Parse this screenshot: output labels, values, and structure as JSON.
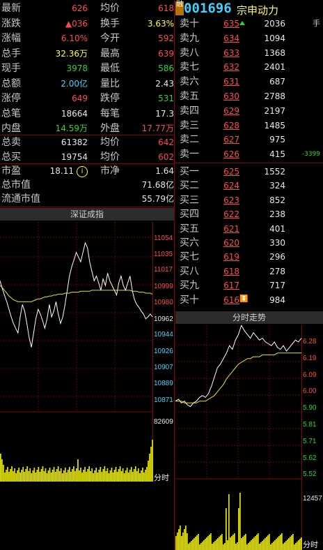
{
  "quote": {
    "rows": [
      {
        "l1": "最新",
        "v1": "626",
        "c1": "red",
        "l2": "均价",
        "v2": "618",
        "c2": "red"
      },
      {
        "l1": "涨跌",
        "v1": "▲036",
        "c1": "red",
        "l2": "换手",
        "v2": "3.63%",
        "c2": "yel"
      },
      {
        "l1": "涨幅",
        "v1": "6.10%",
        "c1": "red",
        "l2": "今开",
        "v2": "592",
        "c2": "red"
      },
      {
        "l1": "总手",
        "v1": "32.36万",
        "c1": "yel",
        "l2": "最高",
        "v2": "639",
        "c2": "red"
      },
      {
        "l1": "现手",
        "v1": "3978",
        "c1": "grn",
        "l2": "最低",
        "v2": "586",
        "c2": "grn"
      },
      {
        "l1": "总额",
        "v1": "2.00亿",
        "c1": "cyan",
        "l2": "量比",
        "v2": "2.43",
        "c2": "wht"
      },
      {
        "l1": "涨停",
        "v1": "649",
        "c1": "red",
        "l2": "跌停",
        "v2": "531",
        "c2": "grn"
      },
      {
        "l1": "总笔",
        "v1": "18664",
        "c1": "wht",
        "l2": "每笔",
        "v2": "17.3",
        "c2": "wht"
      },
      {
        "l1": "内盘",
        "v1": "14.59万",
        "c1": "grn",
        "l2": "外盘",
        "v2": "17.77万",
        "c2": "red"
      }
    ],
    "rows2": [
      {
        "l1": "总卖",
        "v1": "61382",
        "c1": "wht",
        "l2": "均价",
        "v2": "642",
        "c2": "red"
      },
      {
        "l1": "总买",
        "v1": "19754",
        "c1": "wht",
        "l2": "均价",
        "v2": "602",
        "c2": "red"
      }
    ],
    "pe_label": "市盈",
    "pe_value": "18.11",
    "pe_icon": "i",
    "pb_label": "市净",
    "pb_value": "1.64",
    "mcap_label": "总市值",
    "mcap_value": "71.68亿",
    "float_label": "流通市值",
    "float_value": "55.79亿"
  },
  "stock": {
    "code": "001696",
    "name": "宗申动力",
    "badge": "融"
  },
  "orderbook": {
    "sells": [
      {
        "label": "卖十",
        "price": "635",
        "vol": "2036",
        "extra": "手"
      },
      {
        "label": "卖九",
        "price": "634",
        "vol": "1094",
        "extra": ""
      },
      {
        "label": "卖八",
        "price": "633",
        "vol": "1368",
        "extra": ""
      },
      {
        "label": "卖七",
        "price": "632",
        "vol": "2401",
        "extra": ""
      },
      {
        "label": "卖六",
        "price": "631",
        "vol": "687",
        "extra": ""
      },
      {
        "label": "卖五",
        "price": "630",
        "vol": "2788",
        "extra": ""
      },
      {
        "label": "卖四",
        "price": "629",
        "vol": "2197",
        "extra": ""
      },
      {
        "label": "卖三",
        "price": "628",
        "vol": "1485",
        "extra": ""
      },
      {
        "label": "卖二",
        "price": "627",
        "vol": "975",
        "extra": ""
      },
      {
        "label": "卖一",
        "price": "626",
        "vol": "415",
        "extra": "-3399"
      }
    ],
    "buys": [
      {
        "label": "买一",
        "price": "625",
        "vol": "1552"
      },
      {
        "label": "买二",
        "price": "624",
        "vol": "324"
      },
      {
        "label": "买三",
        "price": "623",
        "vol": "852"
      },
      {
        "label": "买四",
        "price": "622",
        "vol": "238"
      },
      {
        "label": "买五",
        "price": "621",
        "vol": "401"
      },
      {
        "label": "买六",
        "price": "620",
        "vol": "330"
      },
      {
        "label": "买七",
        "price": "619",
        "vol": "296"
      },
      {
        "label": "买八",
        "price": "618",
        "vol": "278"
      },
      {
        "label": "买九",
        "price": "617",
        "vol": "717"
      },
      {
        "label": "买十",
        "price": "616",
        "vol": "984"
      }
    ]
  },
  "index_panel": {
    "title": "深证成指",
    "y_labels": [
      "11054",
      "11035",
      "11017",
      "10999",
      "10980",
      "10962",
      "10944",
      "10926",
      "10907",
      "10889",
      "10871"
    ],
    "vol_label": "82609",
    "time_label": "分时"
  },
  "stock_panel": {
    "title": "分时走势",
    "y_labels": [
      "6.28",
      "6.19",
      "6.09",
      "6.00",
      "5.90",
      "5.81",
      "5.71",
      "5.62",
      "5.52"
    ],
    "vol_label": "12457",
    "time_label": "分时"
  },
  "chart_data": [
    {
      "type": "line",
      "title": "深证成指",
      "series": [
        {
          "values": [
            11000,
            10992,
            10985,
            10978,
            10970,
            10962,
            10955,
            10950,
            10945,
            10962,
            10975,
            10968,
            10955,
            10940,
            10930,
            10945,
            10960,
            10970,
            10965,
            10958,
            10950,
            10960,
            10975,
            10962,
            10968,
            10978,
            10965,
            10955,
            10962,
            10975,
            10990,
            11005,
            11015,
            11022,
            11030,
            11025,
            11020,
            11030,
            11040,
            11035,
            11020,
            11010,
            11000,
            11005,
            10998,
            10990,
            11002,
            10995,
            11008,
            11000,
            10995,
            10990,
            10985,
            10998,
            11005,
            10995,
            10990,
            10998,
            11005,
            10990,
            10980,
            10975,
            10972,
            10968,
            10965,
            10960,
            10962,
            10965,
            10962
          ]
        },
        {
          "values": [
            10995,
            10993,
            10990,
            10987,
            10984,
            10982,
            10980,
            10979,
            10978,
            10978,
            10978,
            10978,
            10978,
            10978,
            10978,
            10979,
            10980,
            10981,
            10981,
            10982,
            10983,
            10983,
            10984,
            10984,
            10985,
            10985,
            10986,
            10986,
            10986,
            10987,
            10987,
            10987,
            10988,
            10988,
            10988,
            10988,
            10989,
            10989,
            10989,
            10989,
            10989,
            10990,
            10990,
            10990,
            10990,
            10990,
            10990,
            10990,
            10990,
            10990,
            10990,
            10990,
            10990,
            10990,
            10990,
            10990,
            10990,
            10990,
            10990,
            10989,
            10989,
            10989,
            10988,
            10988,
            10988,
            10987,
            10987,
            10987,
            10986
          ]
        }
      ],
      "ylim": [
        10862,
        11062
      ]
    },
    {
      "type": "line",
      "title": "分时走势",
      "series": [
        {
          "values": [
            5.92,
            5.93,
            5.91,
            5.92,
            5.9,
            5.89,
            5.91,
            5.92,
            5.94,
            5.95,
            5.94,
            5.96,
            6.0,
            6.05,
            6.1,
            6.12,
            6.15,
            6.18,
            6.22,
            6.2,
            6.25,
            6.28,
            6.33,
            6.3,
            6.28,
            6.26,
            6.29,
            6.27,
            6.25,
            6.26,
            6.24,
            6.23,
            6.22,
            6.24,
            6.21,
            6.2,
            6.22,
            6.19,
            6.21,
            6.23,
            6.25,
            6.24,
            6.26
          ]
        },
        {
          "values": [
            5.92,
            5.92,
            5.92,
            5.91,
            5.91,
            5.91,
            5.91,
            5.91,
            5.92,
            5.92,
            5.92,
            5.93,
            5.94,
            5.95,
            5.97,
            5.99,
            6.01,
            6.04,
            6.06,
            6.08,
            6.1,
            6.12,
            6.13,
            6.14,
            6.15,
            6.15,
            6.16,
            6.16,
            6.16,
            6.17,
            6.17,
            6.17,
            6.17,
            6.17,
            6.18,
            6.18,
            6.18,
            6.18,
            6.18,
            6.18,
            6.18,
            6.18,
            6.18
          ]
        }
      ],
      "ylim": [
        5.5,
        6.33
      ]
    }
  ]
}
